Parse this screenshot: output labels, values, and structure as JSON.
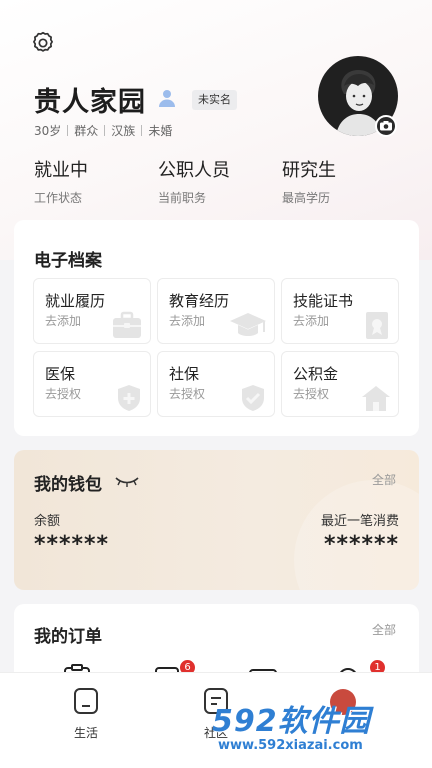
{
  "profile": {
    "name": "贵人家园",
    "real_name_badge": "未实名",
    "meta": [
      "30岁",
      "群众",
      "汉族",
      "未婚"
    ]
  },
  "stats": [
    {
      "value": "就业中",
      "label": "工作状态"
    },
    {
      "value": "公职人员",
      "label": "当前职务"
    },
    {
      "value": "研究生",
      "label": "最高学历"
    }
  ],
  "archive": {
    "title": "电子档案",
    "tiles": [
      {
        "title": "就业履历",
        "sub": "去添加",
        "icon": "briefcase-icon"
      },
      {
        "title": "教育经历",
        "sub": "去添加",
        "icon": "graduation-cap-icon"
      },
      {
        "title": "技能证书",
        "sub": "去添加",
        "icon": "certificate-icon"
      },
      {
        "title": "医保",
        "sub": "去授权",
        "icon": "medical-shield-icon"
      },
      {
        "title": "社保",
        "sub": "去授权",
        "icon": "check-shield-icon"
      },
      {
        "title": "公积金",
        "sub": "去授权",
        "icon": "house-icon"
      }
    ]
  },
  "wallet": {
    "title": "我的钱包",
    "all_label": "全部",
    "balance_label": "余额",
    "balance_value": "******",
    "recent_label": "最近一笔消费",
    "recent_value": "******"
  },
  "orders": {
    "title": "我的订单",
    "all_label": "全部",
    "badges": [
      "6",
      "1"
    ]
  },
  "nav": {
    "items": [
      "生活",
      "社区"
    ]
  },
  "watermark": {
    "brand": "592软件园",
    "url": "www.592xiazai.com"
  },
  "colors": {
    "accent_blue": "#2f7fd3",
    "badge_red": "#e0302d"
  }
}
